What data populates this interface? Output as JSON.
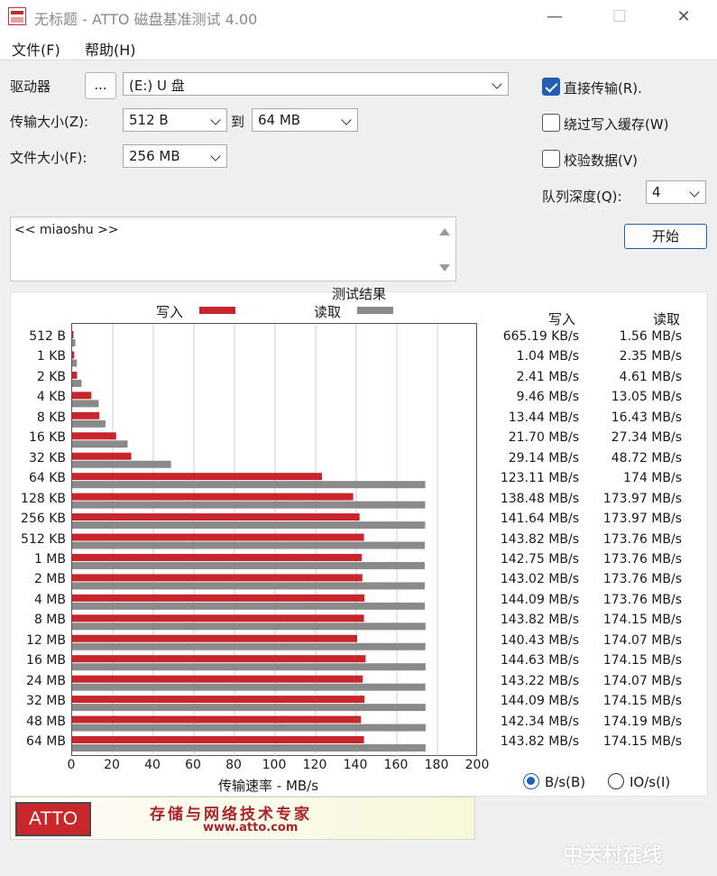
{
  "window": {
    "title": "无标题 - ATTO 磁盘基准测试 4.00",
    "minimize_glyph": "—",
    "maximize_glyph": "☐",
    "close_glyph": "✕"
  },
  "menu": [
    {
      "label": "文件(F)"
    },
    {
      "label": "帮助(H)"
    }
  ],
  "settings": {
    "drive_label": "驱动器",
    "browse_label": "...",
    "drive_value": "(E:) U 盘",
    "transfer_size_label": "传输大小(Z):",
    "transfer_from": "512 B",
    "to_label": "到",
    "transfer_to": "64 MB",
    "file_size_label": "文件大小(F):",
    "file_size": "256 MB",
    "direct_io_label": "直接传输(R).",
    "direct_io_checked": true,
    "bypass_cache_label": "绕过写入缓存(W)",
    "bypass_cache_checked": false,
    "verify_label": "校验数据(V)",
    "verify_checked": false,
    "queue_depth_label": "队列深度(Q):",
    "queue_depth": "4",
    "start_label": "开始"
  },
  "description": {
    "text": "<< miaoshu >>"
  },
  "results": {
    "title": "测试结果",
    "legend_write": "写入",
    "legend_read": "读取",
    "col_write": "写入",
    "col_read": "读取",
    "xlabel": "传输速率 - MB/s",
    "unit_bytes_label": "B/s(B)",
    "unit_io_label": "IO/s(I)",
    "unit_selected": "B/s",
    "rows": [
      {
        "size": "512 B",
        "write": "665.19 KB/s",
        "read": "1.56 MB/s"
      },
      {
        "size": "1 KB",
        "write": "1.04 MB/s",
        "read": "2.35 MB/s"
      },
      {
        "size": "2 KB",
        "write": "2.41 MB/s",
        "read": "4.61 MB/s"
      },
      {
        "size": "4 KB",
        "write": "9.46 MB/s",
        "read": "13.05 MB/s"
      },
      {
        "size": "8 KB",
        "write": "13.44 MB/s",
        "read": "16.43 MB/s"
      },
      {
        "size": "16 KB",
        "write": "21.70 MB/s",
        "read": "27.34 MB/s"
      },
      {
        "size": "32 KB",
        "write": "29.14 MB/s",
        "read": "48.72 MB/s"
      },
      {
        "size": "64 KB",
        "write": "123.11 MB/s",
        "read": "174 MB/s"
      },
      {
        "size": "128 KB",
        "write": "138.48 MB/s",
        "read": "173.97 MB/s"
      },
      {
        "size": "256 KB",
        "write": "141.64 MB/s",
        "read": "173.97 MB/s"
      },
      {
        "size": "512 KB",
        "write": "143.82 MB/s",
        "read": "173.76 MB/s"
      },
      {
        "size": "1 MB",
        "write": "142.75 MB/s",
        "read": "173.76 MB/s"
      },
      {
        "size": "2 MB",
        "write": "143.02 MB/s",
        "read": "173.76 MB/s"
      },
      {
        "size": "4 MB",
        "write": "144.09 MB/s",
        "read": "173.76 MB/s"
      },
      {
        "size": "8 MB",
        "write": "143.82 MB/s",
        "read": "174.15 MB/s"
      },
      {
        "size": "12 MB",
        "write": "140.43 MB/s",
        "read": "174.07 MB/s"
      },
      {
        "size": "16 MB",
        "write": "144.63 MB/s",
        "read": "174.15 MB/s"
      },
      {
        "size": "24 MB",
        "write": "143.22 MB/s",
        "read": "174.07 MB/s"
      },
      {
        "size": "32 MB",
        "write": "144.09 MB/s",
        "read": "174.15 MB/s"
      },
      {
        "size": "48 MB",
        "write": "142.34 MB/s",
        "read": "174.19 MB/s"
      },
      {
        "size": "64 MB",
        "write": "143.82 MB/s",
        "read": "174.15 MB/s"
      }
    ]
  },
  "chart_data": {
    "type": "bar",
    "orientation": "horizontal",
    "categories": [
      "512 B",
      "1 KB",
      "2 KB",
      "4 KB",
      "8 KB",
      "16 KB",
      "32 KB",
      "64 KB",
      "128 KB",
      "256 KB",
      "512 KB",
      "1 MB",
      "2 MB",
      "4 MB",
      "8 MB",
      "12 MB",
      "16 MB",
      "24 MB",
      "32 MB",
      "48 MB",
      "64 MB"
    ],
    "series": [
      {
        "name": "写入",
        "color": "#c8262c",
        "values": [
          0.65,
          1.04,
          2.41,
          9.46,
          13.44,
          21.7,
          29.14,
          123.11,
          138.48,
          141.64,
          143.82,
          142.75,
          143.02,
          144.09,
          143.82,
          140.43,
          144.63,
          143.22,
          144.09,
          142.34,
          143.82
        ]
      },
      {
        "name": "读取",
        "color": "#8a8a8a",
        "values": [
          1.56,
          2.35,
          4.61,
          13.05,
          16.43,
          27.34,
          48.72,
          174,
          173.97,
          173.97,
          173.76,
          173.76,
          173.76,
          173.76,
          174.15,
          174.07,
          174.15,
          174.07,
          174.15,
          174.19,
          174.15
        ]
      }
    ],
    "title": "测试结果",
    "xlabel": "传输速率 - MB/s",
    "xlim": [
      0,
      200
    ],
    "xticks": [
      0,
      20,
      40,
      60,
      80,
      100,
      120,
      140,
      160,
      180,
      200
    ],
    "grid": true,
    "legend": "top"
  },
  "footer": {
    "logo_text": "ATTO",
    "slogan": "存储与网络技术专家",
    "url": "www.atto.com"
  },
  "watermark": {
    "text": "中关村在线"
  },
  "colors": {
    "write": "#c8262c",
    "read": "#8a8a8a",
    "accent": "#1f5fb8"
  }
}
